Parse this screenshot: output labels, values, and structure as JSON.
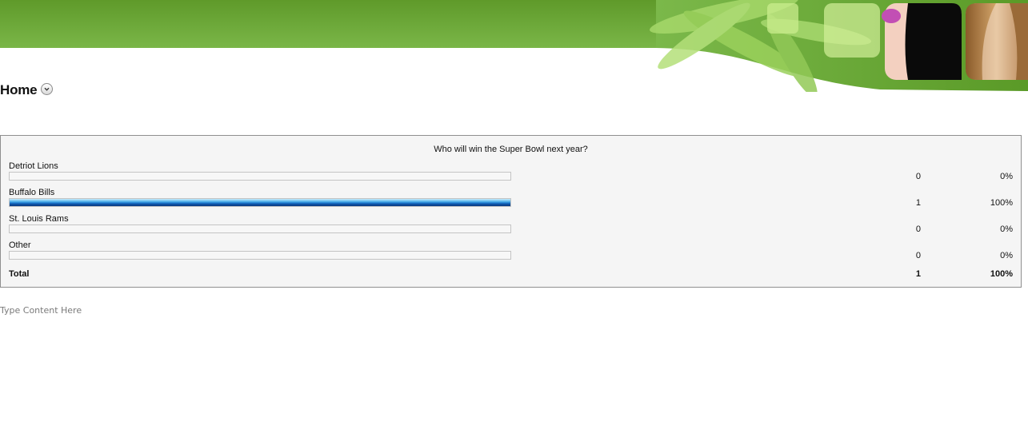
{
  "page": {
    "title": "Home",
    "content_placeholder": "Type Content Here"
  },
  "header": {
    "accent_color": "#6aa83a",
    "icons": [
      "flower-icon"
    ]
  },
  "poll": {
    "question": "Who will win the Super Bowl next year?",
    "bar_color": "#1a74c9",
    "options": [
      {
        "label": "Detriot Lions",
        "count": "0",
        "percent": "0%",
        "fraction": 0
      },
      {
        "label": "Buffalo Bills",
        "count": "1",
        "percent": "100%",
        "fraction": 1
      },
      {
        "label": "St. Louis Rams",
        "count": "0",
        "percent": "0%",
        "fraction": 0
      },
      {
        "label": "Other",
        "count": "0",
        "percent": "0%",
        "fraction": 0
      }
    ],
    "total": {
      "label": "Total",
      "count": "1",
      "percent": "100%"
    }
  }
}
